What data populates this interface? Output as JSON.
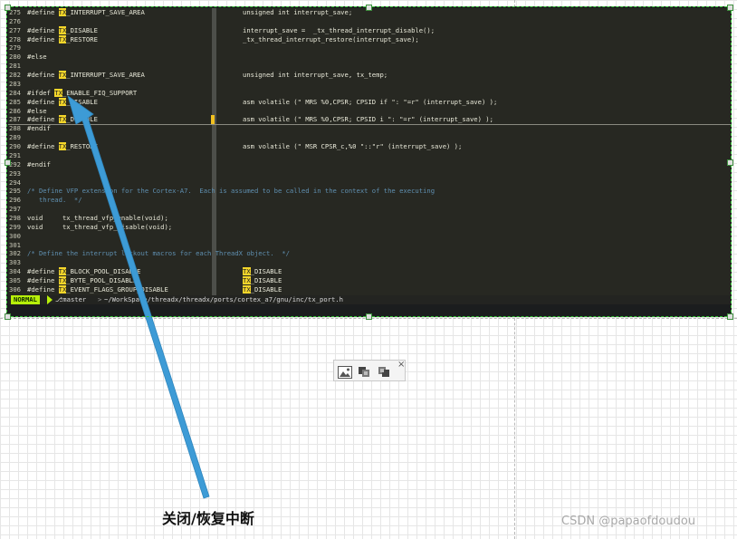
{
  "editor": {
    "lines": [
      {
        "n": "275",
        "left": [
          {
            "t": "#define "
          },
          {
            "t": "TX",
            "hl": true
          },
          {
            "t": "_INTERRUPT_SAVE_AREA"
          }
        ],
        "right": [
          {
            "t": "unsigned int interrupt_save;"
          }
        ]
      },
      {
        "n": "276",
        "left": [],
        "right": []
      },
      {
        "n": "277",
        "left": [
          {
            "t": "#define "
          },
          {
            "t": "TX",
            "hl": true
          },
          {
            "t": "_DISABLE"
          }
        ],
        "right": [
          {
            "t": "interrupt_save =  _tx_thread_interrupt_disable();"
          }
        ]
      },
      {
        "n": "278",
        "left": [
          {
            "t": "#define "
          },
          {
            "t": "TX",
            "hl": true
          },
          {
            "t": "_RESTORE"
          }
        ],
        "right": [
          {
            "t": "_tx_thread_interrupt_restore(interrupt_save);"
          }
        ]
      },
      {
        "n": "279",
        "left": [],
        "right": []
      },
      {
        "n": "280",
        "left": [
          {
            "t": "#else"
          }
        ],
        "right": []
      },
      {
        "n": "281",
        "left": [],
        "right": []
      },
      {
        "n": "282",
        "left": [
          {
            "t": "#define "
          },
          {
            "t": "TX",
            "hl": true
          },
          {
            "t": "_INTERRUPT_SAVE_AREA"
          }
        ],
        "right": [
          {
            "t": "unsigned int interrupt_save, tx_temp;"
          }
        ]
      },
      {
        "n": "283",
        "left": [],
        "right": []
      },
      {
        "n": "284",
        "left": [
          {
            "t": "#ifdef "
          },
          {
            "t": "TX",
            "hl": true
          },
          {
            "t": "_ENABLE_FIQ_SUPPORT"
          }
        ],
        "right": []
      },
      {
        "n": "285",
        "left": [
          {
            "t": "#define "
          },
          {
            "t": "TX",
            "hl": true
          },
          {
            "t": "_DISABLE"
          }
        ],
        "right": [
          {
            "t": "asm volatile (\" MRS %0,CPSR; CPSID if \": \"=r\" (interrupt_save) );"
          }
        ]
      },
      {
        "n": "286",
        "left": [
          {
            "t": "#else"
          }
        ],
        "right": []
      },
      {
        "n": "287",
        "left": [
          {
            "t": "#define "
          },
          {
            "t": "TX",
            "hl": true
          },
          {
            "t": "_DISABLE"
          }
        ],
        "right": [
          {
            "t": "asm volatile (\" MRS %0,CPSR; CPSID i \": \"=r\" (interrupt_save) );"
          }
        ]
      },
      {
        "n": "288",
        "left": [
          {
            "t": "#endif"
          }
        ],
        "right": []
      },
      {
        "n": "289",
        "left": [],
        "right": []
      },
      {
        "n": "290",
        "left": [
          {
            "t": "#define "
          },
          {
            "t": "TX",
            "hl": true
          },
          {
            "t": "_RESTORE"
          }
        ],
        "right": [
          {
            "t": "asm volatile (\" MSR CPSR_c,%0 \"::\"r\" (interrupt_save) );"
          }
        ]
      },
      {
        "n": "291",
        "left": [],
        "right": []
      },
      {
        "n": "292",
        "left": [
          {
            "t": "#endif"
          }
        ],
        "right": []
      },
      {
        "n": "293",
        "left": [],
        "right": []
      },
      {
        "n": "294",
        "left": [],
        "right": []
      },
      {
        "n": "295",
        "left": [
          {
            "t": "/* Define VFP extension for the Cortex-A7.  Each is assumed to be called in the context of the executing",
            "cm": true
          }
        ],
        "right": []
      },
      {
        "n": "296",
        "left": [
          {
            "t": "   thread.  */",
            "cm": true
          }
        ],
        "right": []
      },
      {
        "n": "297",
        "left": [],
        "right": []
      },
      {
        "n": "298",
        "left": [
          {
            "t": "void     tx_thread_vfp_enable(void);"
          }
        ],
        "right": []
      },
      {
        "n": "299",
        "left": [
          {
            "t": "void     tx_thread_vfp_disable(void);"
          }
        ],
        "right": []
      },
      {
        "n": "300",
        "left": [],
        "right": []
      },
      {
        "n": "301",
        "left": [],
        "right": []
      },
      {
        "n": "302",
        "left": [
          {
            "t": "/* Define the interrupt lockout macros for each ThreadX object.  */",
            "cm": true
          }
        ],
        "right": []
      },
      {
        "n": "303",
        "left": [],
        "right": []
      },
      {
        "n": "304",
        "left": [
          {
            "t": "#define "
          },
          {
            "t": "TX",
            "hl": true
          },
          {
            "t": "_BLOCK_POOL_DISABLE"
          }
        ],
        "right": [
          {
            "t": "TX",
            "hl": true
          },
          {
            "t": "_DISABLE"
          }
        ]
      },
      {
        "n": "305",
        "left": [
          {
            "t": "#define "
          },
          {
            "t": "TX",
            "hl": true
          },
          {
            "t": "_BYTE_POOL_DISABLE"
          }
        ],
        "right": [
          {
            "t": "TX",
            "hl": true
          },
          {
            "t": "_DISABLE"
          }
        ]
      },
      {
        "n": "306",
        "left": [
          {
            "t": "#define "
          },
          {
            "t": "TX",
            "hl": true
          },
          {
            "t": "_EVENT_FLAGS_GROUP_DISABLE"
          }
        ],
        "right": [
          {
            "t": "TX",
            "hl": true
          },
          {
            "t": "_DISABLE"
          }
        ]
      }
    ]
  },
  "statusbar": {
    "mode": "NORMAL",
    "branch": "master",
    "separator": ">",
    "path": "~/WorkSpace/threadx/threadx/ports/cortex_a7/gnu/inc/tx_port.h"
  },
  "annotation": {
    "caption": "关闭/恢复中断"
  },
  "watermark": "CSDN @papaofdoudou",
  "toolbar": {
    "close_glyph": "×",
    "icons": [
      "image-icon",
      "copy-icon",
      "duplicate-icon",
      "close-icon"
    ]
  },
  "colors": {
    "editor_bg": "#272822",
    "highlight": "#f4d62a",
    "comment": "#5f8fb0",
    "mode_bg": "#b7f00a",
    "arrow": "#3d9bd6",
    "selection": "#35c335"
  }
}
